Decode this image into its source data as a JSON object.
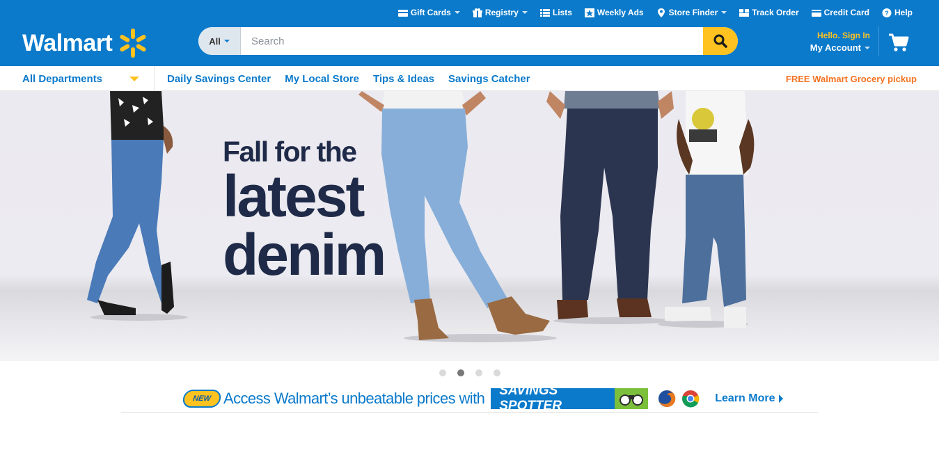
{
  "header": {
    "utility_links": [
      {
        "label": "Gift Cards",
        "icon": "gift-icon",
        "dropdown": true
      },
      {
        "label": "Registry",
        "icon": "gift-box-icon",
        "dropdown": true
      },
      {
        "label": "Lists",
        "icon": "list-icon",
        "dropdown": false
      },
      {
        "label": "Weekly Ads",
        "icon": "star-tag-icon",
        "dropdown": false
      },
      {
        "label": "Store Finder",
        "icon": "location-pin-icon",
        "dropdown": true
      },
      {
        "label": "Track Order",
        "icon": "track-order-icon",
        "dropdown": false
      },
      {
        "label": "Credit Card",
        "icon": "credit-card-icon",
        "dropdown": false
      },
      {
        "label": "Help",
        "icon": "help-icon",
        "dropdown": false
      }
    ],
    "logo_text": "Walmart",
    "search": {
      "department": "All",
      "placeholder": "Search"
    },
    "account": {
      "greeting": "Hello. Sign In",
      "label": "My Account"
    }
  },
  "nav": {
    "departments_label": "All Departments",
    "links": [
      "Daily Savings Center",
      "My Local Store",
      "Tips & Ideas",
      "Savings Catcher"
    ],
    "grocery_label": "FREE Walmart Grocery pickup"
  },
  "hero": {
    "line1": "Fall for the",
    "line2": "latest",
    "line3": "denim"
  },
  "carousel": {
    "count": 4,
    "active_index": 1
  },
  "promo": {
    "badge": "NEW",
    "text": "Access Walmart’s unbeatable prices with",
    "product": "SAVINGS SPOTTER",
    "learn_more": "Learn More"
  },
  "colors": {
    "brand_blue": "#0b7acb",
    "spark_yellow": "#ffc220",
    "grocery_orange": "#f47321",
    "headline_navy": "#1e2a48"
  }
}
